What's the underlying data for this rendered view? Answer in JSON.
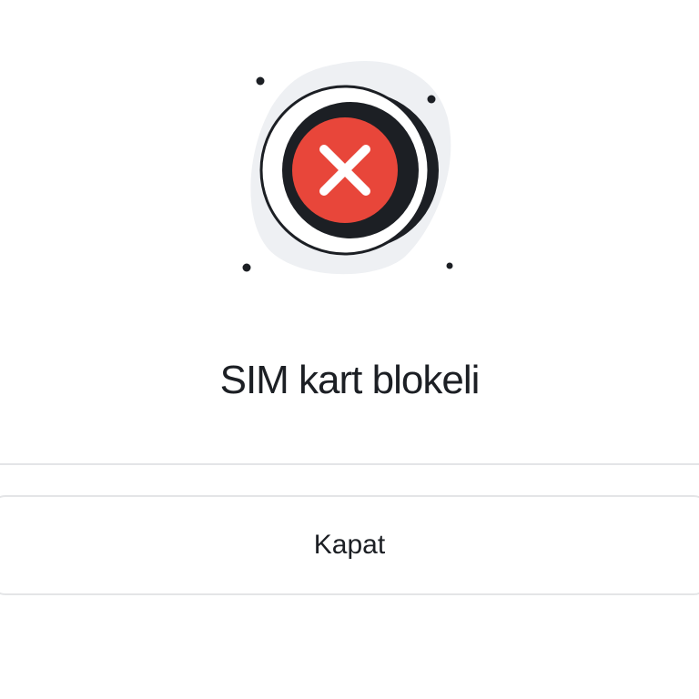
{
  "illustration": {
    "icon": "blocked-x-icon",
    "accent_color": "#e8463a",
    "ring_color": "#1c1f24",
    "blob_color": "#eef0f3"
  },
  "dialog": {
    "title": "SIM kart blokeli",
    "close_label": "Kapat"
  }
}
